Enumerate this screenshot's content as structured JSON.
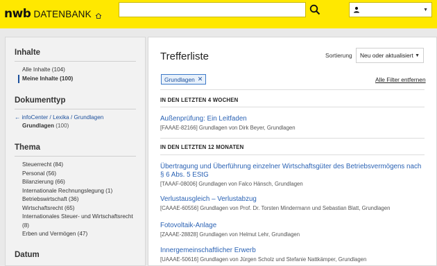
{
  "header": {
    "logo_brand": "nwb",
    "logo_product": "DATENBANK",
    "search_placeholder": "",
    "user_label": ""
  },
  "sidebar": {
    "sections": {
      "inhalte": {
        "title": "Inhalte",
        "items": [
          {
            "label": "Alle Inhalte",
            "count": "(104)"
          },
          {
            "label": "Meine Inhalte",
            "count": "(100)"
          }
        ]
      },
      "dokumenttyp": {
        "title": "Dokumenttyp",
        "back_link": "infoCenter / Lexika / Grundlagen",
        "current_label": "Grundlagen",
        "current_count": "(100)"
      },
      "thema": {
        "title": "Thema",
        "items": [
          "Steuerrecht (84)",
          "Personal (56)",
          "Bilanzierung (66)",
          "Internationale Rechnungslegung (1)",
          "Betriebswirtschaft (36)",
          "Wirtschaftsrecht (65)",
          "Internationales Steuer- und Wirtschaftsrecht (8)",
          "Erben und Vermögen (47)"
        ]
      },
      "datum": {
        "title": "Datum"
      }
    }
  },
  "main": {
    "title": "Trefferliste",
    "sort_label": "Sortierung",
    "sort_value": "Neu oder aktualisiert",
    "filter_chip": "Grundlagen",
    "remove_filters": "Alle Filter entfernen",
    "groups": [
      {
        "header": "IN DEN LETZTEN 4 WOCHEN",
        "results": [
          {
            "title": "Außenprüfung: Ein Leitfaden",
            "meta": "[FAAAE-82166] Grundlagen von Dirk Beyer, Grundlagen"
          }
        ]
      },
      {
        "header": "IN DEN LETZTEN 12 MONATEN",
        "results": [
          {
            "title": "Übertragung und Überführung einzelner Wirtschaftsgüter des Betriebsvermögens nach § 6 Abs. 5 EStG",
            "meta": "[TAAAF-08006] Grundlagen von Falco Hänsch, Grundlagen"
          },
          {
            "title": "Verlustausgleich – Verlustabzug",
            "meta": "[CAAAE-60556] Grundlagen von Prof. Dr. Torsten Mindermann und Sebastian Blatt, Grundlagen"
          },
          {
            "title": "Fotovoltaik-Anlage",
            "meta": "[ZAAAE-28828] Grundlagen von Helmut Lehr, Grundlagen"
          },
          {
            "title": "Innergemeinschaftlicher Erwerb",
            "meta": "[UAAAE-50616] Grundlagen von Jürgen Scholz und Stefanie Nattkämper, Grundlagen"
          }
        ]
      }
    ]
  },
  "colors": {
    "header_bg": "#ffe800",
    "link": "#2a62b4",
    "accent": "#1b4f9c"
  }
}
